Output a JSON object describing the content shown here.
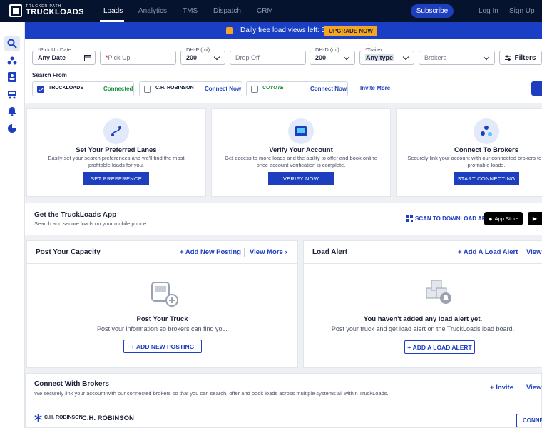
{
  "nav": {
    "logo_small": "TRUCKER PATH",
    "logo_big": "TRUCKLOADS",
    "items": [
      "Loads",
      "Analytics",
      "TMS",
      "Dispatch",
      "CRM"
    ],
    "subscribe": "Subscribe",
    "login": "Log In",
    "signup": "Sign Up"
  },
  "sidebar": {
    "icons": [
      "search-icon",
      "network-icon",
      "contacts-icon",
      "truck-icon",
      "bell-icon",
      "pie-chart-icon"
    ]
  },
  "banner": {
    "text": "Daily free load views left: 5",
    "upgrade": "UPGRADE NOW"
  },
  "search": {
    "pickup_date_label": "Pick Up Date",
    "pickup_date_value": "Any Date",
    "pickup_placeholder": "Pick Up",
    "dhp_label": "DH-P (mi)",
    "dhp_value": "200",
    "dropoff_placeholder": "Drop Off",
    "dhd_label": "DH-D (mi)",
    "dhd_value": "200",
    "trailer_label": "Trailer",
    "trailer_value": "Any type",
    "brokers_placeholder": "Brokers",
    "filters": "Filters",
    "search_from": "Search From",
    "sources": [
      {
        "logo": "TRUCKLOADS",
        "status": "Connected"
      },
      {
        "logo": "C.H. ROBINSON",
        "status": "Connect Now"
      },
      {
        "logo": "COYOTE",
        "status": "Connect Now"
      }
    ],
    "invite_more": "Invite More"
  },
  "cards": [
    {
      "title": "Set Your Preferred Lanes",
      "desc": "Easily set your search preferences and we'll find the most profitable loads for you.",
      "button": "SET PREFERENCE"
    },
    {
      "title": "Verify Your Account",
      "desc": "Get access to more loads and the ability to offer and book online once account verification is complete.",
      "button": "VERIFY NOW"
    },
    {
      "title": "Connect To Brokers",
      "desc": "Securely link your account with our connected brokers to see more profitable loads.",
      "button": "START CONNECTING"
    }
  ],
  "app": {
    "title": "Get the TruckLoads App",
    "subtitle": "Search and secure loads on your mobile phone.",
    "scan": "SCAN TO DOWNLOAD APP",
    "app_store": "App Store"
  },
  "capacity": {
    "title": "Post Your Capacity",
    "add": "Add New Posting",
    "view": "View More",
    "empty_title": "Post Your Truck",
    "empty_desc": "Post your information so brokers can find you.",
    "button": "ADD NEW POSTING"
  },
  "alert": {
    "title": "Load Alert",
    "add": "Add A Load Alert",
    "view": "View",
    "empty_title": "You haven't added any load alert yet.",
    "empty_desc": "Post your truck and get load alert on the TruckLoads load board.",
    "button": "ADD A LOAD ALERT"
  },
  "brokers": {
    "title": "Connect With Brokers",
    "subtitle": "We securely link your account with our connected brokers so that you can search, offer and book loads across multiple systems all within TruckLoads.",
    "invite": "Invite",
    "view": "View",
    "rows": [
      {
        "logo": "C.H. ROBINSON",
        "name": "C.H. ROBINSON",
        "button": "CONNE"
      }
    ]
  }
}
